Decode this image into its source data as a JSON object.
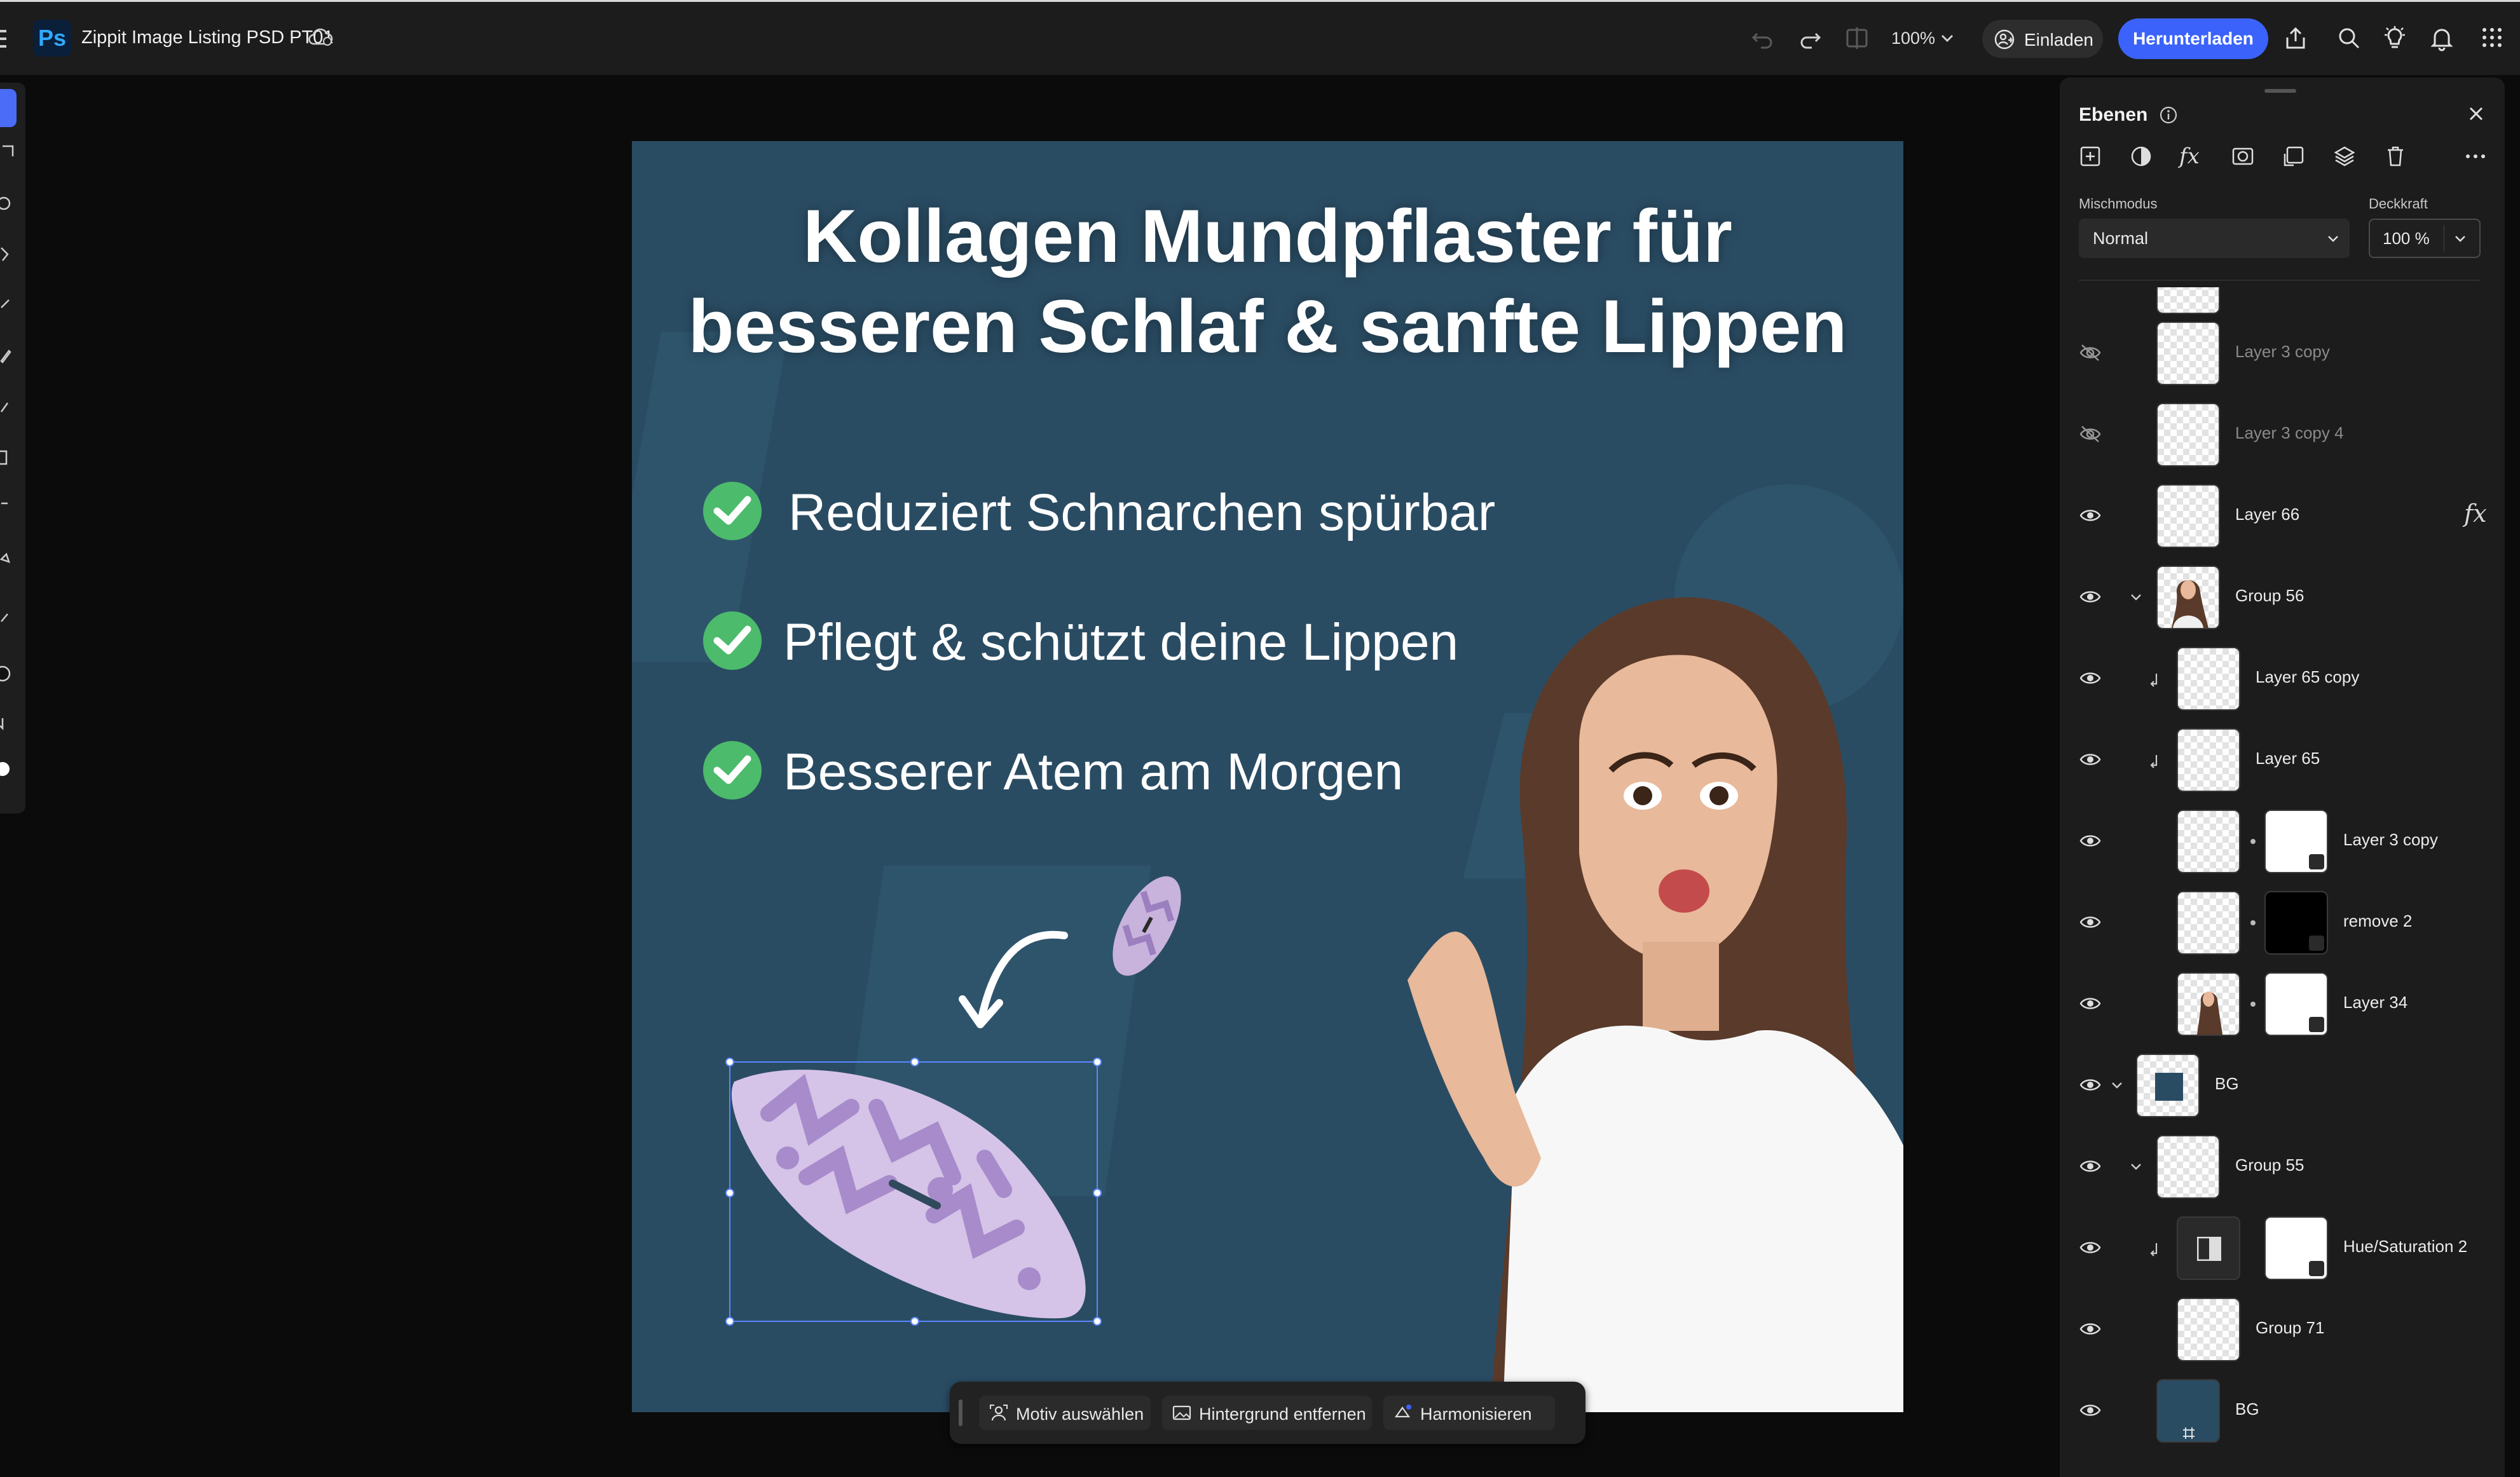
{
  "app": {
    "logo_text": "Ps",
    "document_title": "Zippit Image Listing PSD PT01",
    "zoom": "100%",
    "invite_label": "Einladen",
    "download_label": "Herunterladen",
    "accent_color": "#3b63fb"
  },
  "toolbar": {
    "icons": [
      "undo-icon",
      "redo-icon",
      "compare-icon",
      "share-icon",
      "search-icon",
      "lightbulb-icon",
      "bell-icon",
      "apps-grid-icon"
    ]
  },
  "canvas": {
    "headline_line1": "Kollagen Mundpflaster für",
    "headline_line2": "besseren Schlaf & sanfte Lippen",
    "bullets": [
      "Reduziert Schnarchen spürbar",
      "Pflegt & schützt deine Lippen",
      "Besserer Atem am Morgen"
    ],
    "background_color": "#2a4c63",
    "check_color": "#4cbb6c"
  },
  "context_bar": {
    "select_subject": "Motiv auswählen",
    "remove_background": "Hintergrund entfernen",
    "harmonize": "Harmonisieren"
  },
  "layers_panel": {
    "title": "Ebenen",
    "blend_mode_label": "Mischmodus",
    "blend_mode_value": "Normal",
    "opacity_label": "Deckkraft",
    "opacity_value": "100 %",
    "layers": [
      {
        "name": "Layer 3 copy",
        "visible": false
      },
      {
        "name": "Layer 3 copy 4",
        "visible": false
      },
      {
        "name": "Layer 66",
        "visible": true,
        "fx": true
      },
      {
        "name": "Group 56",
        "visible": true
      },
      {
        "name": "Layer 65 copy",
        "visible": true
      },
      {
        "name": "Layer 65",
        "visible": true
      },
      {
        "name": "Layer 3 copy",
        "visible": true
      },
      {
        "name": "remove 2",
        "visible": true
      },
      {
        "name": "Layer 34",
        "visible": true
      },
      {
        "name": "BG",
        "visible": true
      },
      {
        "name": "Group 55",
        "visible": true
      },
      {
        "name": "Hue/Saturation 2",
        "visible": true
      },
      {
        "name": "Group 71",
        "visible": true
      },
      {
        "name": "BG",
        "visible": true
      }
    ],
    "fx_label": "fx"
  }
}
